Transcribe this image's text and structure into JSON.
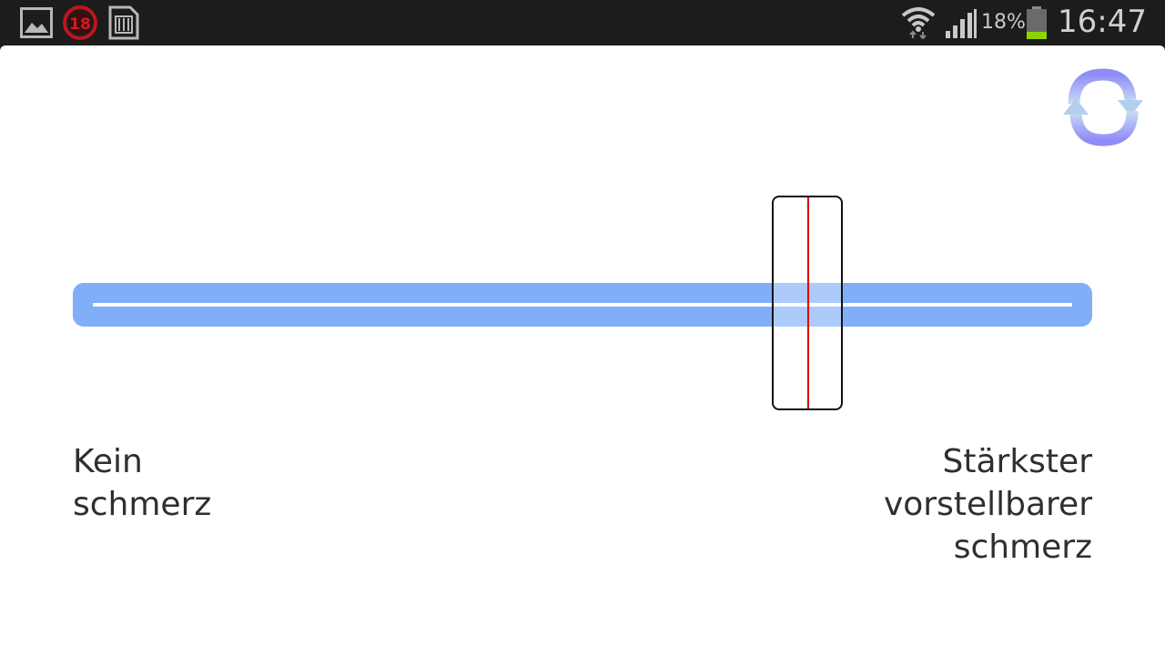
{
  "status_bar": {
    "icons_left": [
      "gallery-notification-icon",
      "age-18-notification-icon",
      "sd-card-icon"
    ],
    "icons_right": [
      "wifi-icon",
      "cell-signal-icon",
      "battery-icon"
    ],
    "battery_percent": "18%",
    "battery_level": 0.18,
    "time": "16:47",
    "colors": {
      "battery_fill": "#8fd400",
      "age_badge": "#c0141c"
    }
  },
  "reset_button": {
    "icon": "refresh-icon",
    "colors": [
      "#8e8cf6",
      "#9cc4ee"
    ]
  },
  "pain_scale": {
    "value": 0.73,
    "track_color": "#80aef8",
    "marker_color": "#e00000",
    "label_min": [
      "Kein",
      "schmerz"
    ],
    "label_max": [
      "Stärkster",
      "vorstellbarer",
      "schmerz"
    ]
  }
}
